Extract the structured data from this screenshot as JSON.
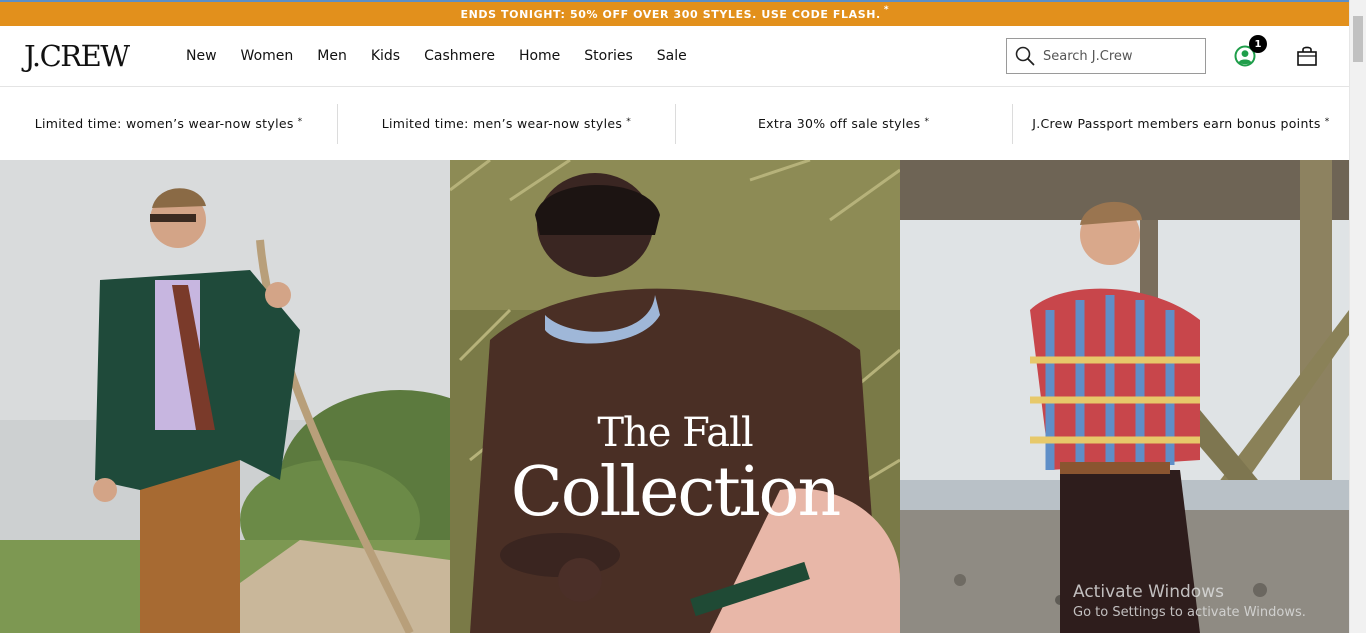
{
  "promo_bar": {
    "text": "ENDS TONIGHT: 50% OFF OVER 300 STYLES. USE CODE FLASH.",
    "marker": "*"
  },
  "header": {
    "logo": "J.CREW",
    "nav": [
      "New",
      "Women",
      "Men",
      "Kids",
      "Cashmere",
      "Home",
      "Stories",
      "Sale"
    ],
    "search": {
      "placeholder": "Search J.Crew",
      "icon": "search-icon"
    },
    "account": {
      "icon": "account-icon",
      "badge": "1"
    },
    "bag": {
      "icon": "shopping-bag-icon"
    }
  },
  "promo_strip": [
    {
      "label": "Limited time: women’s wear-now styles",
      "marker": "*"
    },
    {
      "label": "Limited time: men’s wear-now styles",
      "marker": "*"
    },
    {
      "label": "Extra 30% off sale styles",
      "marker": "*"
    },
    {
      "label": "J.Crew Passport members earn bonus points",
      "marker": "*"
    }
  ],
  "hero": {
    "title_line1": "The Fall",
    "title_line2": "Collection"
  },
  "watermark": {
    "line1": "Activate Windows",
    "line2": "Go to Settings to activate Windows."
  },
  "colors": {
    "promo_bar": "#e2901c",
    "account_icon": "#1f9e4a",
    "text": "#111111"
  }
}
